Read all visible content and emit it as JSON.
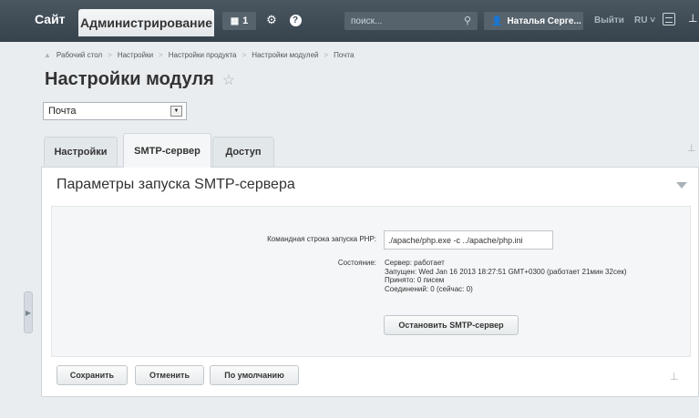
{
  "topbar": {
    "site_tab": "Сайт",
    "admin_tab": "Администрирование",
    "notifications_count": "1",
    "search_placeholder": "поиск...",
    "user_name": "Наталья Серге...",
    "logout": "Выйти",
    "language": "RU ˅"
  },
  "breadcrumb": {
    "items": [
      "Рабочий стол",
      "Настройки",
      "Настройки продукта",
      "Настройки модулей",
      "Почта"
    ],
    "separator": ">"
  },
  "page": {
    "title": "Настройки модуля",
    "module_select_value": "Почта"
  },
  "tabs": [
    {
      "label": "Настройки",
      "active": false
    },
    {
      "label": "SMTP-сервер",
      "active": true
    },
    {
      "label": "Доступ",
      "active": false
    }
  ],
  "panel": {
    "title": "Параметры запуска SMTP-сервера",
    "php_cmd_label": "Командная строка запуска PHP:",
    "php_cmd_value": "./apache/php.exe -c ../apache/php.ini",
    "status_label": "Состояние:",
    "status_lines": [
      "Сервер: работает",
      "Запущен: Wed Jan 16 2013 18:27:51 GMT+0300 (работает 21мин 32сек)",
      "Принято: 0 писем",
      "Соединений: 0 (сейчас: 0)"
    ],
    "stop_button": "Остановить SMTP-сервер"
  },
  "footer": {
    "save": "Сохранить",
    "cancel": "Отменить",
    "default": "По умолчанию"
  }
}
